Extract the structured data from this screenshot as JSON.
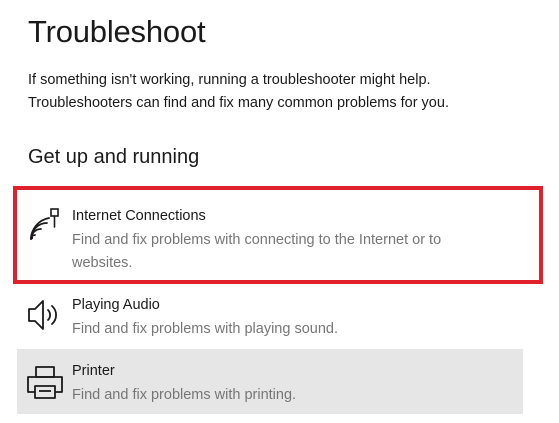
{
  "page": {
    "title": "Troubleshoot",
    "description_line1": "If something isn't working, running a troubleshooter might help.",
    "description_line2": "Troubleshooters can find and fix many common problems for you."
  },
  "section": {
    "heading": "Get up and running"
  },
  "troubleshooters": [
    {
      "title": "Internet Connections",
      "description_line1": "Find and fix problems with connecting to the Internet or to",
      "description_line2": "websites.",
      "icon": "wifi-network-icon",
      "highlighted": true
    },
    {
      "title": "Playing Audio",
      "description": "Find and fix problems with playing sound.",
      "icon": "speaker-icon"
    },
    {
      "title": "Printer",
      "description": "Find and fix problems with printing.",
      "icon": "printer-icon",
      "selected": true
    }
  ],
  "colors": {
    "highlight_border": "#e0202a",
    "selected_background": "#e6e6e6",
    "secondary_text": "#767676"
  }
}
